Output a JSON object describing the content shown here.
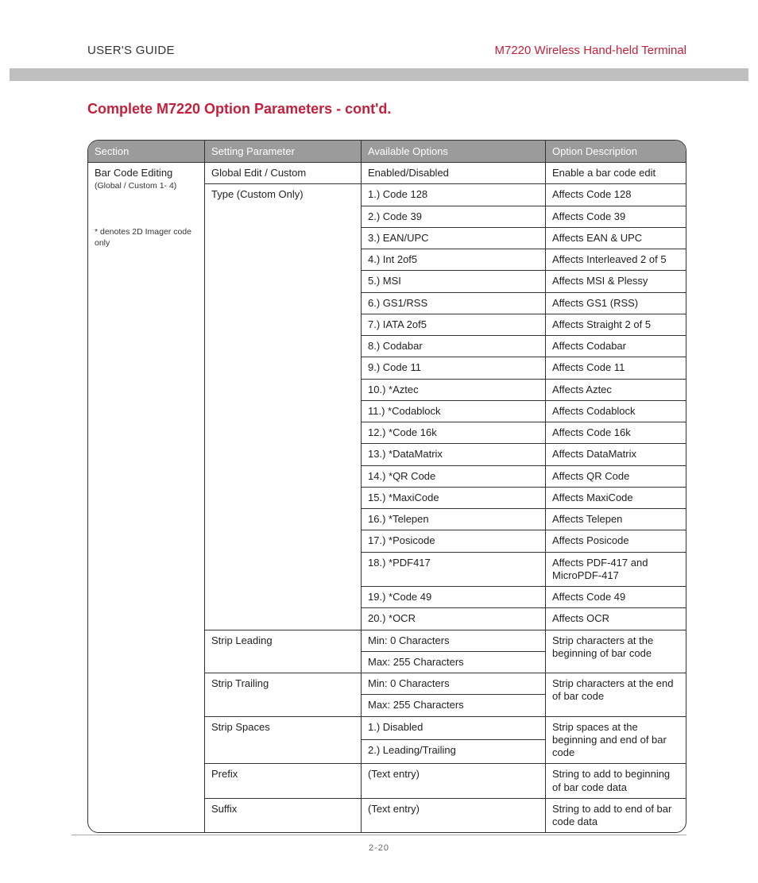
{
  "header": {
    "left": "USER'S GUIDE",
    "right": "M7220 Wireless Hand-held Terminal"
  },
  "title": "Complete M7220 Option Parameters - cont'd.",
  "columns": [
    "Section",
    "Setting Parameter",
    "Available Options",
    "Option Description"
  ],
  "section": {
    "name": "Bar Code Editing",
    "note": "(Global / Custom 1- 4)",
    "footnote": "* denotes 2D Imager code only"
  },
  "rows": [
    {
      "param": "Global Edit / Custom",
      "opt": "Enabled/Disabled",
      "desc": "Enable a bar code edit"
    },
    {
      "param": "Type (Custom Only)",
      "opt": "1.) Code 128",
      "desc": "Affects Code 128"
    },
    {
      "param": "",
      "opt": "2.) Code 39",
      "desc": "Affects Code 39"
    },
    {
      "param": "",
      "opt": "3.) EAN/UPC",
      "desc": "Affects EAN & UPC"
    },
    {
      "param": "",
      "opt": "4.) Int 2of5",
      "desc": "Affects Interleaved 2 of 5"
    },
    {
      "param": "",
      "opt": "5.) MSI",
      "desc": "Affects MSI & Plessy"
    },
    {
      "param": "",
      "opt": "6.) GS1/RSS",
      "desc": "Affects GS1 (RSS)"
    },
    {
      "param": "",
      "opt": "7.) IATA 2of5",
      "desc": "Affects Straight 2 of 5"
    },
    {
      "param": "",
      "opt": "8.) Codabar",
      "desc": "Affects Codabar"
    },
    {
      "param": "",
      "opt": "9.) Code 11",
      "desc": "Affects Code 11"
    },
    {
      "param": "",
      "opt": "10.) *Aztec",
      "desc": "Affects Aztec"
    },
    {
      "param": "",
      "opt": "11.) *Codablock",
      "desc": "Affects Codablock"
    },
    {
      "param": "",
      "opt": "12.) *Code 16k",
      "desc": "Affects Code 16k"
    },
    {
      "param": "",
      "opt": "13.) *DataMatrix",
      "desc": "Affects DataMatrix"
    },
    {
      "param": "",
      "opt": "14.) *QR Code",
      "desc": "Affects QR Code"
    },
    {
      "param": "",
      "opt": "15.) *MaxiCode",
      "desc": "Affects MaxiCode"
    },
    {
      "param": "",
      "opt": "16.) *Telepen",
      "desc": "Affects Telepen"
    },
    {
      "param": "",
      "opt": "17.) *Posicode",
      "desc": "Affects Posicode"
    },
    {
      "param": "",
      "opt": "18.) *PDF417",
      "desc": "Affects PDF-417  and MicroPDF-417"
    },
    {
      "param": "",
      "opt": "19.) *Code 49",
      "desc": "Affects Code 49"
    },
    {
      "param": "",
      "opt": "20.) *OCR",
      "desc": "Affects OCR"
    },
    {
      "param": "Strip Leading",
      "opt": "Min: 0 Characters",
      "desc": "Strip characters at the beginning of bar code",
      "descSpan": 2
    },
    {
      "param": "",
      "opt": "Max: 255 Characters"
    },
    {
      "param": "Strip Trailing",
      "opt": "Min: 0 Characters",
      "desc": "Strip characters at the end of bar code",
      "descSpan": 2
    },
    {
      "param": "",
      "opt": "Max: 255 Characters"
    },
    {
      "param": "Strip Spaces",
      "opt": "1.) Disabled",
      "desc": "Strip spaces at the beginning and end of bar code",
      "descSpan": 2
    },
    {
      "param": "",
      "opt": "2.) Leading/Trailing"
    },
    {
      "param": "Prefix",
      "opt": "(Text entry)",
      "desc": "String to add to beginning of bar code data"
    },
    {
      "param": "Suffix",
      "opt": "(Text entry)",
      "desc": "String to add to end of bar code data"
    }
  ],
  "pageNumber": "2-20"
}
